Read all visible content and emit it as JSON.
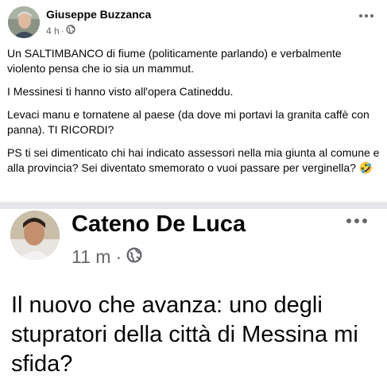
{
  "post1": {
    "author": "Giuseppe Buzzanca",
    "time": "4 h",
    "separator": "·",
    "paragraphs": [
      "Un SALTIMBANCO di fiume (politicamente parlando) e verbalmente violento pensa che io sia un mammut.",
      "I Messinesi ti hanno visto all'opera Catineddu.",
      "Levaci manu e tornatene al paese (da dove mi portavi la granita caffè con panna). TI RICORDI?",
      "PS ti sei dimenticato chi hai indicato assessori nella mia giunta al comune e alla provincia? Sei diventato smemorato o vuoi passare per verginella? 🤣"
    ],
    "more_icon": "more-horizontal-icon",
    "privacy_icon": "globe-icon"
  },
  "post2": {
    "author": "Cateno De Luca",
    "time": "11 m",
    "separator": "·",
    "text": "Il nuovo che avanza: uno degli stupratori della città di Messina mi sfida?",
    "more_icon": "more-horizontal-icon",
    "privacy_icon": "globe-icon"
  },
  "colors": {
    "text": "#050505",
    "secondary": "#65676b",
    "divider": "#e4e6eb",
    "background": "#ffffff"
  }
}
